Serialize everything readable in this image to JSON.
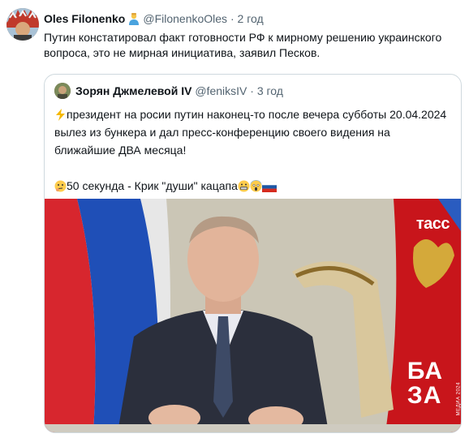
{
  "tweet": {
    "author_name": "Oles Filonenko",
    "author_handle": "@FilonenkoOles",
    "separator": "·",
    "time": "2 год",
    "text": "Путин констатировал факт готовности РФ к мирному решению украинского вопроса, это не мирная инициатива, заявил Песков."
  },
  "quote": {
    "author_name": "Зорян Джмелевой IV",
    "author_handle": "@feniksIV",
    "separator": "·",
    "time": "3 год",
    "text_line1": "президент на росии путин наконец-то после вечера субботы 20.04.2024 вылез из бункера и дал пресс-конференцию своего видения на ближайшие ДВА месяца!",
    "text_line2": "50 секунда - Крик \"души\" кацапа",
    "media": {
      "tass_label": "тасс",
      "baza_logo_top": "БА",
      "baza_logo_bottom": "ЗА",
      "baza_side_text": "МЕДИА 2024"
    }
  },
  "colors": {
    "text_primary": "#0f1419",
    "text_secondary": "#536471",
    "border": "#cfd9de"
  }
}
